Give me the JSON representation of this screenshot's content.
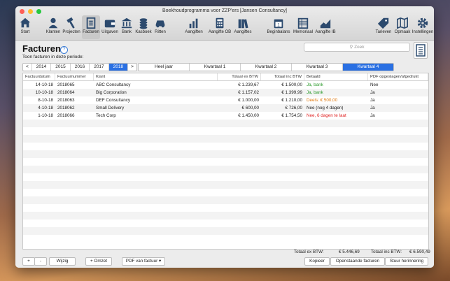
{
  "window": {
    "title": "Boekhoudprogramma voor ZZP'ers [Jansen Consultancy]"
  },
  "toolbar": {
    "items": [
      {
        "label": "Start",
        "icon": "house-icon"
      },
      {
        "label": "Klanten",
        "icon": "person-icon"
      },
      {
        "label": "Projecten",
        "icon": "hammer-icon"
      },
      {
        "label": "Facturen",
        "icon": "invoice-icon"
      },
      {
        "label": "Uitgaven",
        "icon": "wallet-icon"
      },
      {
        "label": "Bank",
        "icon": "bank-icon"
      },
      {
        "label": "Kasboek",
        "icon": "coins-icon"
      },
      {
        "label": "Ritten",
        "icon": "car-icon"
      },
      {
        "label": "Aangiften",
        "icon": "bar-chart-icon"
      },
      {
        "label": "Aangifte OB",
        "icon": "calculator-icon"
      },
      {
        "label": "Aangiftes",
        "icon": "books-icon"
      },
      {
        "label": "Beginbalans",
        "icon": "calendar-icon"
      },
      {
        "label": "Memoriaal",
        "icon": "ledger-icon"
      },
      {
        "label": "Aangifte IB",
        "icon": "line-chart-icon"
      },
      {
        "label": "Tarieven",
        "icon": "tag-icon"
      },
      {
        "label": "Opmaak",
        "icon": "map-icon"
      },
      {
        "label": "Instellingen",
        "icon": "gear-icon"
      }
    ]
  },
  "page": {
    "title": "Facturen",
    "help": "?",
    "subtitle": "Toon facturen in deze periode:",
    "search_placeholder": "Zoek"
  },
  "years": {
    "prev": "<",
    "next": ">",
    "items": [
      "2014",
      "2015",
      "2016",
      "2017",
      "2018"
    ],
    "selected": "2018"
  },
  "periods": {
    "items": [
      "Heel jaar",
      "Kwartaal 1",
      "Kwartaal 2",
      "Kwartaal 3",
      "Kwartaal 4"
    ],
    "selected": "Kwartaal 4"
  },
  "table": {
    "columns": [
      "Factuurdatum",
      "Factuurnummer",
      "Klant",
      "Totaal ex BTW",
      "Totaal inc BTW",
      "Betaald",
      "PDF opgeslagen/afgedrukt"
    ],
    "rows": [
      {
        "date": "14-10-18",
        "number": "2018065",
        "client": "ABC Consultancy",
        "ex": "€ 1.239,67",
        "inc": "€ 1.500,00",
        "paid": "Ja, bank",
        "paid_status": "green",
        "pdf": "Nee"
      },
      {
        "date": "10-10-18",
        "number": "2018064",
        "client": "Big Corporation",
        "ex": "€ 1.157,02",
        "inc": "€ 1.399,99",
        "paid": "Ja, bank",
        "paid_status": "green",
        "pdf": "Ja"
      },
      {
        "date": "8-10-18",
        "number": "2018063",
        "client": "DEF Consultancy",
        "ex": "€ 1.000,00",
        "inc": "€ 1.210,00",
        "paid": "Deels: € 500,00",
        "paid_status": "orange",
        "pdf": "Ja"
      },
      {
        "date": "4-10-18",
        "number": "2018062",
        "client": "Small Delivery",
        "ex": "€ 600,00",
        "inc": "€ 726,00",
        "paid": "Nee (nog 4 dagen)",
        "paid_status": "black",
        "pdf": "Ja"
      },
      {
        "date": "1-10-18",
        "number": "2018066",
        "client": "Tech Corp",
        "ex": "€ 1.450,00",
        "inc": "€ 1.754,50",
        "paid": "Nee, 6 dagen te laat",
        "paid_status": "red",
        "pdf": "Ja"
      }
    ]
  },
  "totals": {
    "ex_label": "Totaal ex BTW:",
    "ex_value": "€ 5.446,69",
    "inc_label": "Totaal inc BTW:",
    "inc_value": "€ 6.590,49"
  },
  "buttons": {
    "add": "+",
    "remove": "-",
    "edit": "Wijzig",
    "omzet": "+ Omzet",
    "pdf": "PDF van factuur",
    "copy": "Kopieer",
    "open": "Openstaande facturen",
    "reminder": "Stuur herinnering"
  },
  "colors": {
    "accent": "#2a70e3",
    "paid_green": "#2a9a2a",
    "partial_orange": "#e07a10",
    "late_red": "#e02525"
  }
}
